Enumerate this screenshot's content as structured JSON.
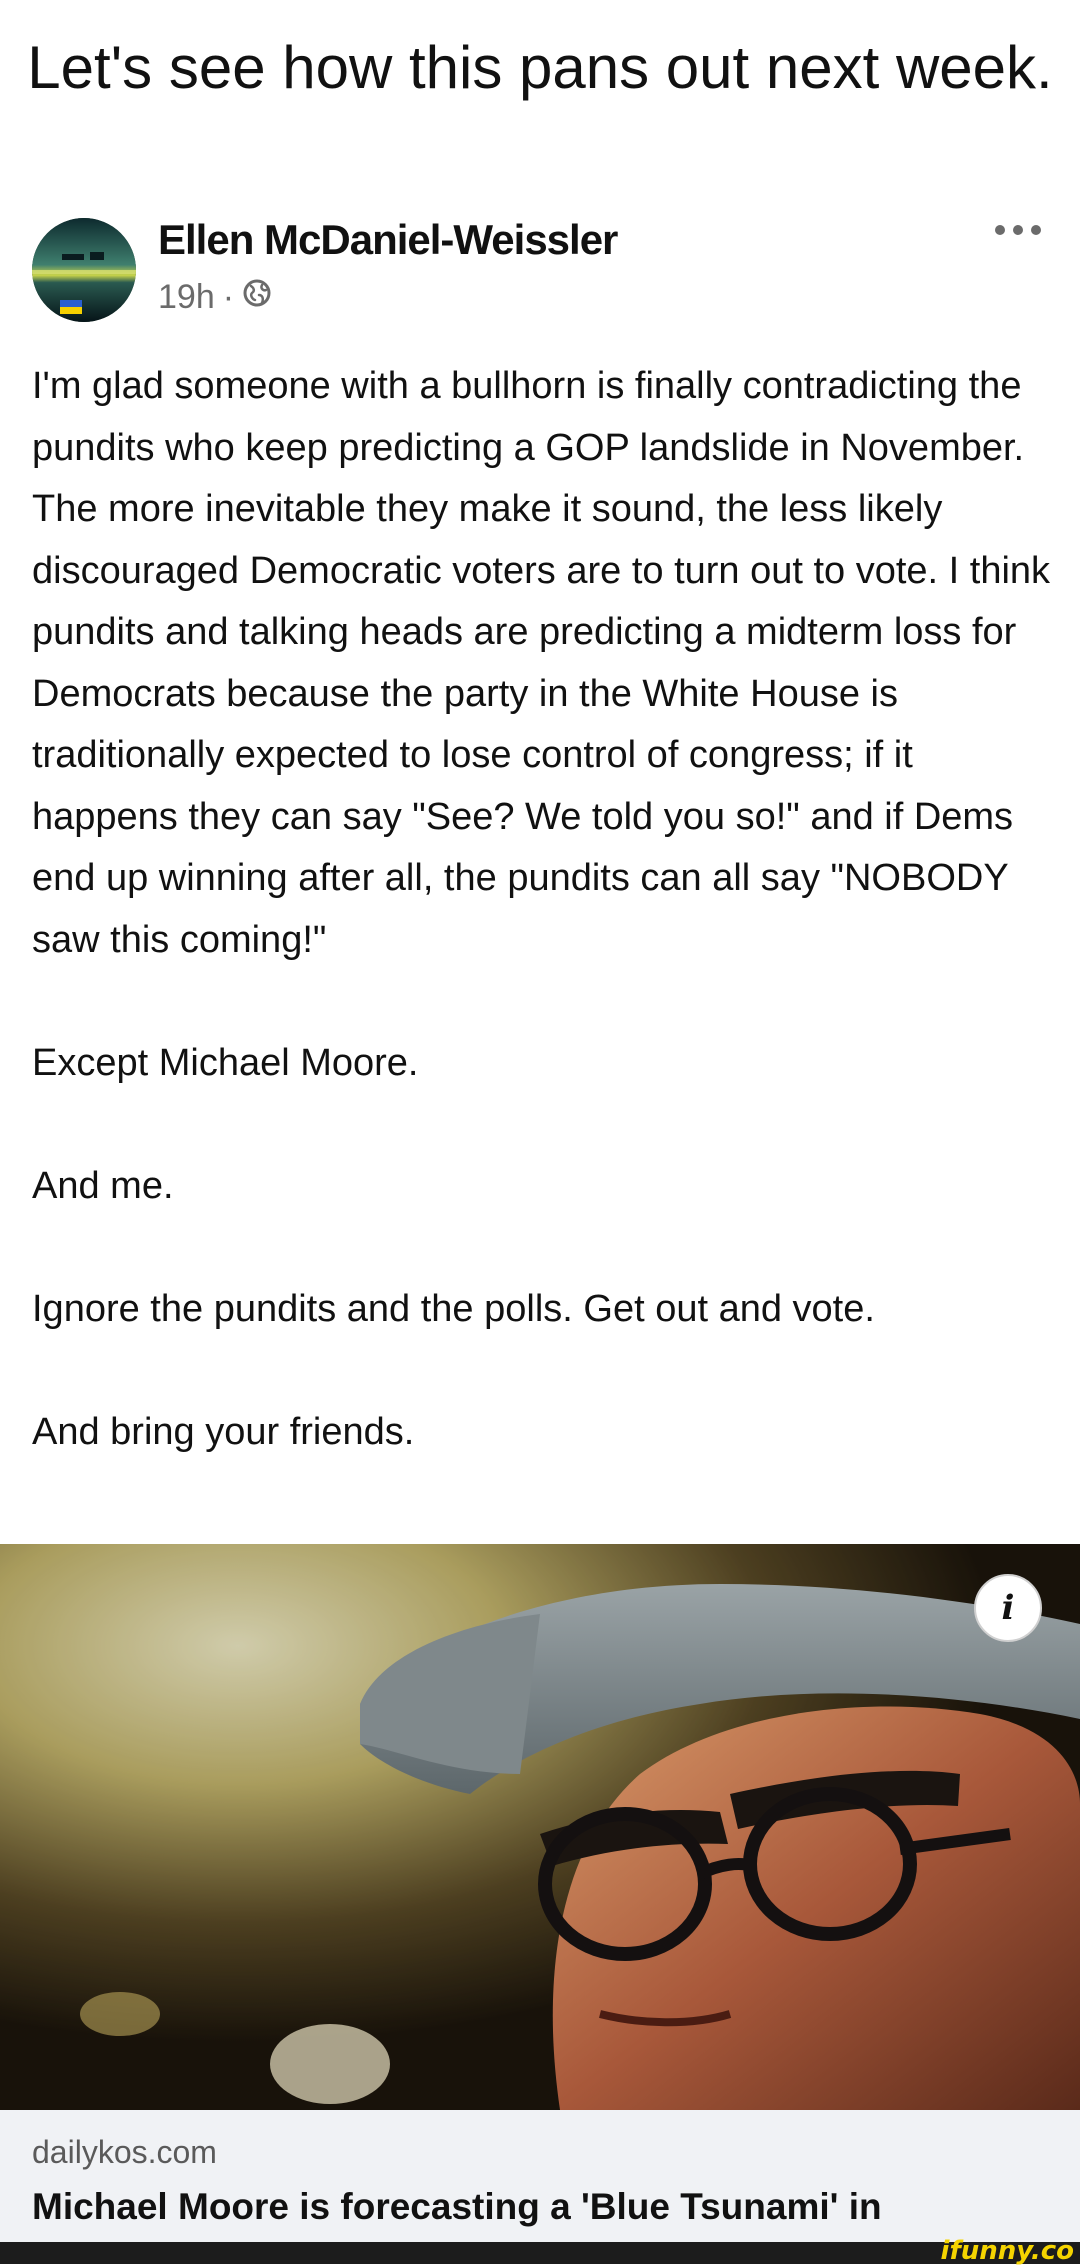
{
  "caption": "Let's see how this pans out next week.",
  "post": {
    "author": "Ellen McDaniel-Weissler",
    "time": "19h",
    "separator": "·",
    "paragraphs": [
      "I'm glad someone with a bullhorn is finally contradicting the pundits who keep predicting a GOP landslide in November. The more inevitable they make it sound, the less likely discouraged Democratic voters are to turn out to vote. I think pundits and talking heads are predicting a midterm loss for Democrats because the party in the White House is traditionally expected to lose control of congress; if it happens they can say \"See? We told you so!\" and if Dems end up winning after all,  the pundits can all say \"NOBODY saw this coming!\"",
      "Except Michael Moore.",
      "And me.",
      "Ignore the pundits and the polls. Get out and vote.",
      "And bring your friends."
    ]
  },
  "link": {
    "info_label": "i",
    "domain": "dailykos.com",
    "title": "Michael Moore is forecasting a 'Blue Tsunami' in"
  },
  "watermark": "ifunny.co",
  "icons": {
    "more": "more-horizontal-icon",
    "audience": "globe-icon",
    "info": "info-icon"
  },
  "colors": {
    "text": "#111111",
    "meta": "#6b6b6b",
    "link_footer_bg": "#f0f2f5",
    "watermark": "#f5d400"
  }
}
